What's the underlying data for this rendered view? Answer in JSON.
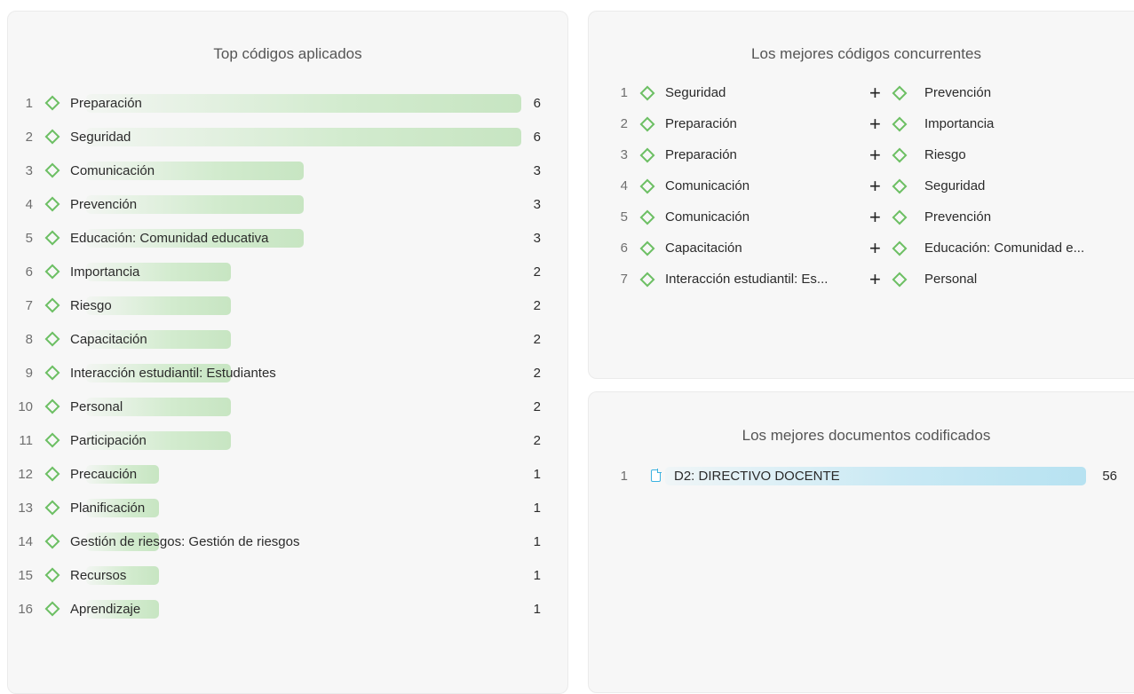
{
  "codes_panel": {
    "title": "Top códigos aplicados",
    "max_count": 6,
    "items": [
      {
        "rank": "1",
        "name": "Preparación",
        "count": "6",
        "value": 6
      },
      {
        "rank": "2",
        "name": "Seguridad",
        "count": "6",
        "value": 6
      },
      {
        "rank": "3",
        "name": "Comunicación",
        "count": "3",
        "value": 3
      },
      {
        "rank": "4",
        "name": "Prevención",
        "count": "3",
        "value": 3
      },
      {
        "rank": "5",
        "name": "Educación: Comunidad educativa",
        "count": "3",
        "value": 3
      },
      {
        "rank": "6",
        "name": "Importancia",
        "count": "2",
        "value": 2
      },
      {
        "rank": "7",
        "name": "Riesgo",
        "count": "2",
        "value": 2
      },
      {
        "rank": "8",
        "name": "Capacitación",
        "count": "2",
        "value": 2
      },
      {
        "rank": "9",
        "name": "Interacción estudiantil: Estudiantes",
        "count": "2",
        "value": 2
      },
      {
        "rank": "10",
        "name": "Personal",
        "count": "2",
        "value": 2
      },
      {
        "rank": "11",
        "name": "Participación",
        "count": "2",
        "value": 2
      },
      {
        "rank": "12",
        "name": "Precaución",
        "count": "1",
        "value": 1
      },
      {
        "rank": "13",
        "name": "Planificación",
        "count": "1",
        "value": 1
      },
      {
        "rank": "14",
        "name": "Gestión de riesgos: Gestión de riesgos",
        "count": "1",
        "value": 1
      },
      {
        "rank": "15",
        "name": "Recursos",
        "count": "1",
        "value": 1
      },
      {
        "rank": "16",
        "name": "Aprendizaje",
        "count": "1",
        "value": 1
      }
    ]
  },
  "cooccurrence_panel": {
    "title": "Los mejores códigos concurrentes",
    "plus_symbol": "+",
    "pairs": [
      {
        "rank": "1",
        "left": "Seguridad",
        "right": "Prevención"
      },
      {
        "rank": "2",
        "left": "Preparación",
        "right": "Importancia"
      },
      {
        "rank": "3",
        "left": "Preparación",
        "right": "Riesgo"
      },
      {
        "rank": "4",
        "left": "Comunicación",
        "right": "Seguridad"
      },
      {
        "rank": "5",
        "left": "Comunicación",
        "right": "Prevención"
      },
      {
        "rank": "6",
        "left": "Capacitación",
        "right": "Educación: Comunidad e..."
      },
      {
        "rank": "7",
        "left": "Interacción estudiantil: Es...",
        "right": "Personal"
      }
    ]
  },
  "documents_panel": {
    "title": "Los mejores documentos codificados",
    "items": [
      {
        "rank": "1",
        "name": "D2: DIRECTIVO DOCENTE",
        "count": "56",
        "value": 56
      }
    ]
  },
  "icons": {
    "code": "code-diamond-icon",
    "document": "document-icon"
  },
  "colors": {
    "code_icon": "#6cbf63",
    "code_bar": "#c7e5c2",
    "document_icon": "#3bb2e0",
    "document_bar": "#b7e2f1"
  }
}
